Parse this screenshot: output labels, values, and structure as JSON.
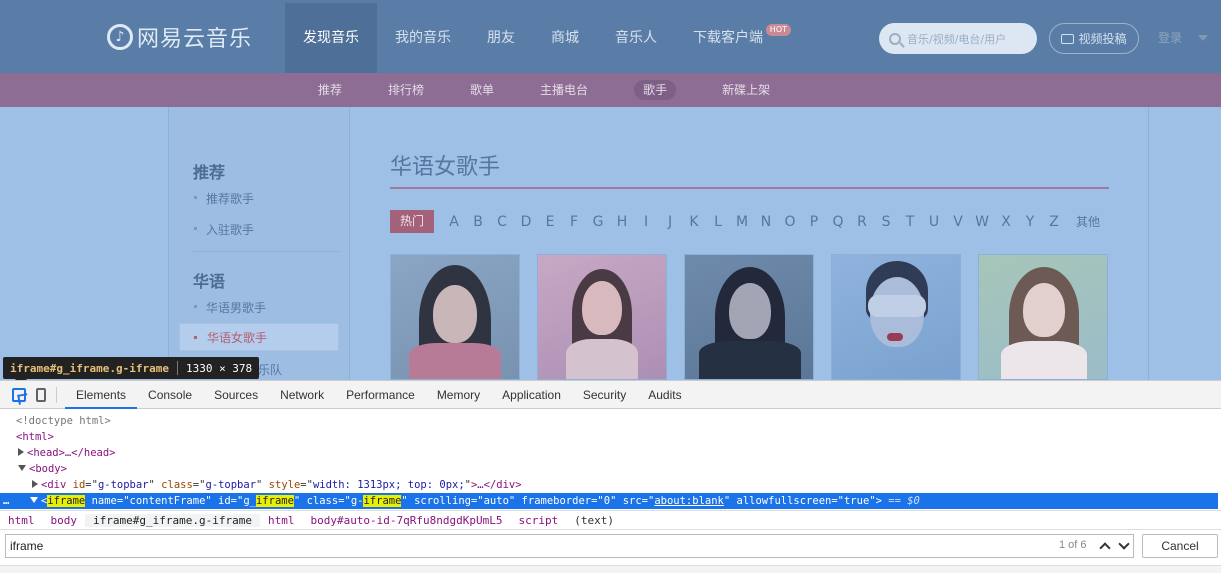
{
  "topbar": {
    "logo_text": "网易云音乐",
    "nav": [
      "发现音乐",
      "我的音乐",
      "朋友",
      "商城",
      "音乐人",
      "下载客户端"
    ],
    "hot_badge": "HOT",
    "search_placeholder": "音乐/视频/电台/用户",
    "upload_label": "视频投稿",
    "login_label": "登录"
  },
  "subnav": [
    "推荐",
    "排行榜",
    "歌单",
    "主播电台",
    "歌手",
    "新碟上架"
  ],
  "sidebar": {
    "groups": [
      {
        "heading": "推荐",
        "items": [
          "推荐歌手",
          "入驻歌手"
        ]
      },
      {
        "heading": "华语",
        "items": [
          "华语男歌手",
          "华语女歌手",
          "华语组合/乐队"
        ]
      }
    ],
    "partial_item_visible": "合/乐队"
  },
  "main": {
    "title": "华语女歌手",
    "hot_filter": "热门",
    "letters": [
      "A",
      "B",
      "C",
      "D",
      "E",
      "F",
      "G",
      "H",
      "I",
      "J",
      "K",
      "L",
      "M",
      "N",
      "O",
      "P",
      "Q",
      "R",
      "S",
      "T",
      "U",
      "V",
      "W",
      "X",
      "Y",
      "Z"
    ],
    "other": "其他"
  },
  "tooltip": {
    "selector": "iframe#g_iframe.g-iframe",
    "size": "1330 × 378"
  },
  "devtools": {
    "tabs": [
      "Elements",
      "Console",
      "Sources",
      "Network",
      "Performance",
      "Memory",
      "Application",
      "Security",
      "Audits"
    ],
    "dom": {
      "doctype": "<!doctype html>",
      "html_open": "<html>",
      "head": "<head>…</head>",
      "body_open": "<body>",
      "div_tag": "div",
      "div_attrs": [
        [
          "id",
          "g-topbar"
        ],
        [
          "class",
          "g-topbar"
        ],
        [
          "style",
          "width: 1313px; top: 0px;"
        ]
      ],
      "div_tail": ">…</div>",
      "iframe_tag": "iframe",
      "iframe_name": "contentFrame",
      "iframe_id_pre": "g_",
      "iframe_match": "iframe",
      "iframe_class_pre": "g-",
      "iframe_scrolling": "auto",
      "iframe_frameborder": "0",
      "iframe_src": "about:blank",
      "iframe_allowfullscreen": "true",
      "eq": "== $0"
    },
    "breadcrumbs": [
      "html",
      "body",
      "iframe#g_iframe.g-iframe",
      "html",
      "body#auto-id-7qRfu8ndgdKpUmL5",
      "script",
      "(text)"
    ],
    "find": {
      "query": "iframe",
      "count": "1 of 6",
      "cancel": "Cancel"
    }
  },
  "colors": {
    "topbar": "#5a7da7",
    "subnav": "#8d6d93",
    "content": "#9fc0e6",
    "accent": "#1a73e8"
  }
}
